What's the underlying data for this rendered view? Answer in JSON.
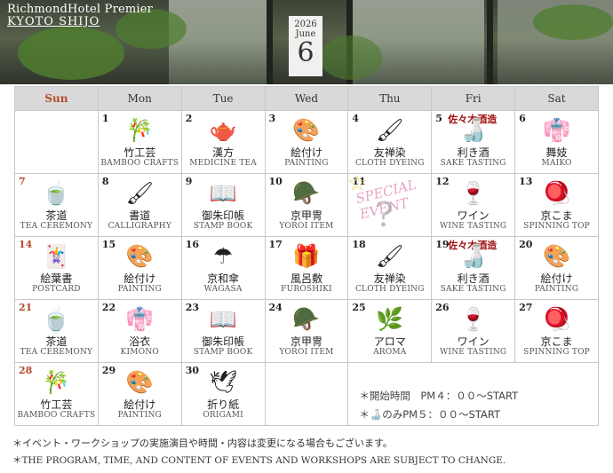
{
  "header": {
    "brand_line1": "RichmondHotel Premier",
    "brand_line2": "KYOTO SHIJO",
    "year": "2026",
    "month": "June",
    "month_num": "6"
  },
  "weekdays": [
    "Sun",
    "Mon",
    "Tue",
    "Wed",
    "Thu",
    "Fri",
    "Sat"
  ],
  "weeks": [
    [
      {},
      {
        "day": "1",
        "icon": "🎋",
        "jp": "竹工芸",
        "en": "BAMBOO CRAFTS"
      },
      {
        "day": "2",
        "icon": "🫖",
        "jp": "漢方",
        "en": "MEDICINE TEA"
      },
      {
        "day": "3",
        "icon": "🎨",
        "jp": "絵付け",
        "en": "PAINTING"
      },
      {
        "day": "4",
        "icon": "🖌",
        "jp": "友禅染",
        "en": "CLOTH DYEING"
      },
      {
        "day": "5",
        "icon": "🍶",
        "jp": "利き酒",
        "en": "SAKE TASTING",
        "shop": "佐々木酒造"
      },
      {
        "day": "6",
        "icon": "👘",
        "jp": "舞妓",
        "en": "MAIKO"
      }
    ],
    [
      {
        "day": "7",
        "icon": "🍵",
        "jp": "茶道",
        "en": "TEA CEREMONY",
        "sun": true
      },
      {
        "day": "8",
        "icon": "🖌",
        "jp": "書道",
        "en": "CALLIGRAPHY"
      },
      {
        "day": "9",
        "icon": "📖",
        "jp": "御朱印帳",
        "en": "STAMP BOOK"
      },
      {
        "day": "10",
        "icon": "🪖",
        "jp": "京甲冑",
        "en": "YOROI ITEM"
      },
      {
        "day": "11",
        "special": "SPECIAL EVENT",
        "q": "?"
      },
      {
        "day": "12",
        "icon": "🍷",
        "jp": "ワイン",
        "en": "WINE TASTING"
      },
      {
        "day": "13",
        "icon": "🪀",
        "jp": "京こま",
        "en": "SPINNING TOP"
      }
    ],
    [
      {
        "day": "14",
        "icon": "🃏",
        "jp": "絵葉書",
        "en": "POSTCARD",
        "sun": true
      },
      {
        "day": "15",
        "icon": "🎨",
        "jp": "絵付け",
        "en": "PAINTING"
      },
      {
        "day": "16",
        "icon": "☂",
        "jp": "京和傘",
        "en": "WAGASA"
      },
      {
        "day": "17",
        "icon": "🎁",
        "jp": "風呂敷",
        "en": "FUROSHIKI"
      },
      {
        "day": "18",
        "icon": "🖌",
        "jp": "友禅染",
        "en": "CLOTH DYEING"
      },
      {
        "day": "19",
        "icon": "🍶",
        "jp": "利き酒",
        "en": "SAKE TASTING",
        "shop": "佐々木酒造"
      },
      {
        "day": "20",
        "icon": "🎨",
        "jp": "絵付け",
        "en": "PAINTING"
      }
    ],
    [
      {
        "day": "21",
        "icon": "🍵",
        "jp": "茶道",
        "en": "TEA CEREMONY",
        "sun": true
      },
      {
        "day": "22",
        "icon": "👘",
        "jp": "浴衣",
        "en": "KIMONO"
      },
      {
        "day": "23",
        "icon": "📖",
        "jp": "御朱印帳",
        "en": "STAMP BOOK"
      },
      {
        "day": "24",
        "icon": "🪖",
        "jp": "京甲冑",
        "en": "YOROI ITEM"
      },
      {
        "day": "25",
        "icon": "🌿",
        "jp": "アロマ",
        "en": "AROMA"
      },
      {
        "day": "26",
        "icon": "🍷",
        "jp": "ワイン",
        "en": "WINE TASTING"
      },
      {
        "day": "27",
        "icon": "🪀",
        "jp": "京こま",
        "en": "SPINNING TOP"
      }
    ],
    [
      {
        "day": "28",
        "icon": "🎋",
        "jp": "竹工芸",
        "en": "BAMBOO CRAFTS",
        "sun": true
      },
      {
        "day": "29",
        "icon": "🎨",
        "jp": "絵付け",
        "en": "PAINTING"
      },
      {
        "day": "30",
        "icon": "🕊",
        "jp": "折り紙",
        "en": "ORIGAMI"
      },
      {},
      {
        "notes": true
      }
    ]
  ],
  "notes": {
    "line1": "＊開始時間　PM４：００～START",
    "line2": "＊🍶のみPM５：００～START"
  },
  "footer": {
    "jp": "＊イベント・ワークショップの実施演目や時間・内容は変更になる場合もございます。",
    "en": "＊THE PROGRAM, TIME, AND CONTENT OF EVENTS AND WORKSHOPS ARE SUBJECT TO CHANGE."
  }
}
